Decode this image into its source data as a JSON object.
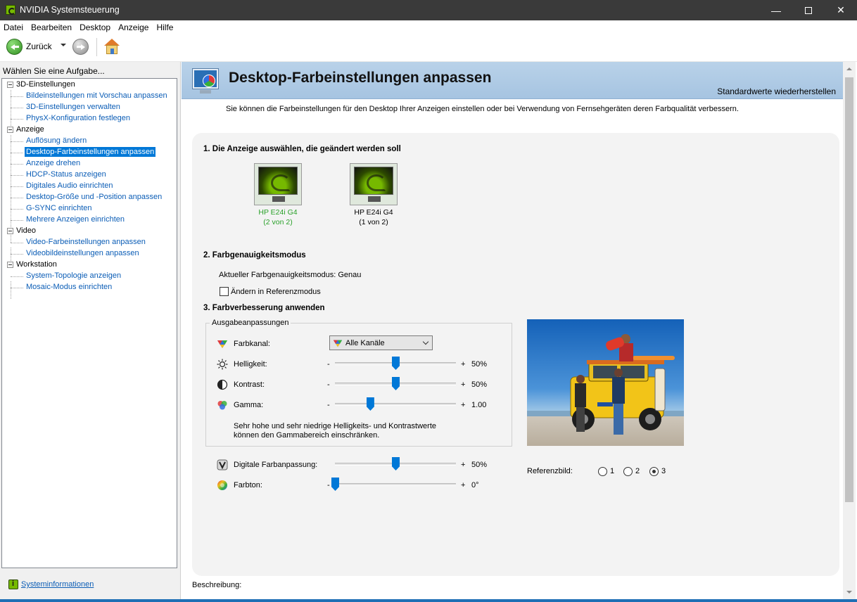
{
  "window": {
    "title": "NVIDIA Systemsteuerung",
    "min_glyph": "—",
    "close_glyph": "✕"
  },
  "menu": [
    "Datei",
    "Bearbeiten",
    "Desktop",
    "Anzeige",
    "Hilfe"
  ],
  "toolbar": {
    "back_label": "Zurück",
    "icons": [
      "back-arrow-icon",
      "dropdown-arrow-icon",
      "forward-arrow-icon",
      "home-icon"
    ]
  },
  "sidebar": {
    "task_label": "Wählen Sie eine Aufgabe...",
    "categories": [
      {
        "label": "3D-Einstellungen",
        "items": [
          "Bildeinstellungen mit Vorschau anpassen",
          "3D-Einstellungen verwalten",
          "PhysX-Konfiguration festlegen"
        ]
      },
      {
        "label": "Anzeige",
        "items": [
          "Auflösung ändern",
          "Desktop-Farbeinstellungen anpassen",
          "Anzeige drehen",
          "HDCP-Status anzeigen",
          "Digitales Audio einrichten",
          "Desktop-Größe und -Position anpassen",
          "G-SYNC einrichten",
          "Mehrere Anzeigen einrichten"
        ]
      },
      {
        "label": "Video",
        "items": [
          "Video-Farbeinstellungen anpassen",
          "Videobildeinstellungen anpassen"
        ]
      },
      {
        "label": "Workstation",
        "items": [
          "System-Topologie anzeigen",
          "Mosaic-Modus einrichten"
        ]
      }
    ],
    "selected_item": "Desktop-Farbeinstellungen anpassen",
    "sysinfo_label": "Systeminformationen"
  },
  "page": {
    "title": "Desktop-Farbeinstellungen anpassen",
    "restore_label": "Standardwerte wiederherstellen",
    "intro": "Sie können die Farbeinstellungen für den Desktop Ihrer Anzeigen einstellen oder bei Verwendung von Fernsehgeräten deren Farbqualität verbessern.",
    "section1": "1. Die Anzeige auswählen, die geändert werden soll",
    "displays": [
      {
        "name": "HP E24i G4",
        "index": "(2 von 2)",
        "selected": true
      },
      {
        "name": "HP E24i G4",
        "index": "(1 von 2)",
        "selected": false
      }
    ],
    "section2": "2. Farbgenauigkeitsmodus",
    "current_mode": "Aktueller Farbgenauigkeitsmodus: Genau",
    "reference_mode_label": "Ändern in Referenzmodus",
    "reference_mode_checked": false,
    "section3": "3. Farbverbesserung anwenden",
    "output_group": "Ausgabeanpassungen",
    "channel_label": "Farbkanal:",
    "channel_value": "Alle Kanäle",
    "brightness": {
      "label": "Helligkeit:",
      "value": "50%",
      "level": 0.5
    },
    "contrast": {
      "label": "Kontrast:",
      "value": "50%",
      "level": 0.5
    },
    "gamma": {
      "label": "Gamma:",
      "value": "1.00",
      "level": 0.29
    },
    "note_line1": "Sehr hohe und sehr niedrige Helligkeits- und Kontrastwerte",
    "note_line2": "können den Gammabereich einschränken.",
    "vibrance": {
      "label": "Digitale Farbanpassung:",
      "value": "50%",
      "level": 0.5
    },
    "hue": {
      "label": "Farbton:",
      "value": "0°",
      "level": 0.0
    },
    "minus": "-",
    "plus": "+",
    "reference_image_label": "Referenzbild:",
    "reference_options": [
      "1",
      "2",
      "3"
    ],
    "reference_selected": "3",
    "description_label": "Beschreibung:"
  },
  "colors": {
    "selected_display_text": "#2aa12a",
    "accent": "#0078d7",
    "header_bg": "#b3cde6",
    "link": "#0b5db6"
  }
}
